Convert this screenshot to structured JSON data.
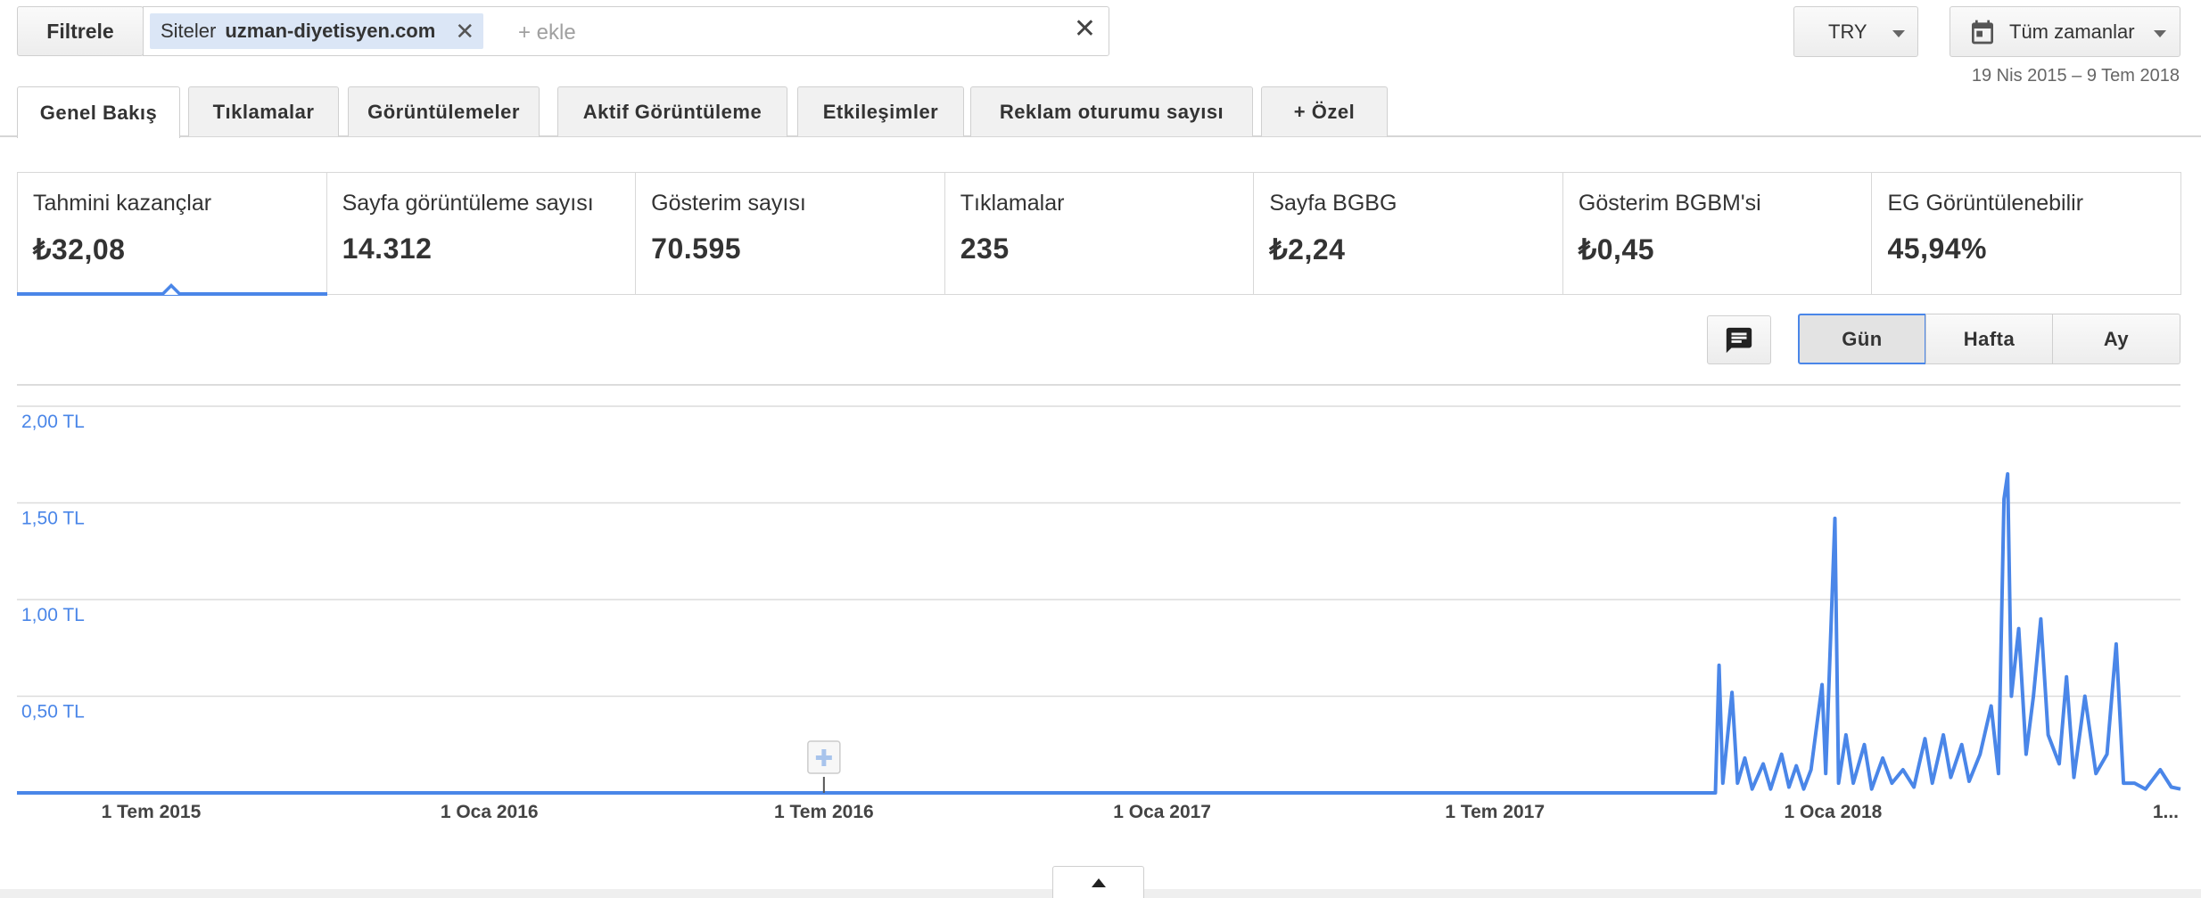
{
  "filter": {
    "button_label": "Filtrele",
    "chip_prefix": "Siteler",
    "chip_value": "uzman-diyetisyen.com",
    "add_placeholder": "+ ekle"
  },
  "currency": {
    "label": "TRY"
  },
  "time_range": {
    "label": "Tüm zamanlar",
    "range_text": "19 Nis 2015 – 9 Tem 2018"
  },
  "tabs": [
    {
      "label": "Genel Bakış",
      "active": true
    },
    {
      "label": "Tıklamalar"
    },
    {
      "label": "Görüntülemeler"
    },
    {
      "label": "Aktif Görüntüleme"
    },
    {
      "label": "Etkileşimler"
    },
    {
      "label": "Reklam oturumu sayısı"
    },
    {
      "label": "+ Özel"
    }
  ],
  "metrics": [
    {
      "label": "Tahmini kazançlar",
      "value": "₺32,08",
      "selected": true
    },
    {
      "label": "Sayfa görüntüleme sayısı",
      "value": "14.312"
    },
    {
      "label": "Gösterim sayısı",
      "value": "70.595"
    },
    {
      "label": "Tıklamalar",
      "value": "235"
    },
    {
      "label": "Sayfa BGBG",
      "value": "₺2,24"
    },
    {
      "label": "Gösterim BGBM'si",
      "value": "₺0,45"
    },
    {
      "label": "EG Görüntülenebilir",
      "value": "45,94%"
    }
  ],
  "granularity": {
    "day": "Gün",
    "week": "Hafta",
    "month": "Ay",
    "selected": "Gün"
  },
  "icons": {
    "comment": "comment-icon",
    "calendar": "calendar-icon",
    "clear": "close-icon",
    "collapse": "chevron-up-icon",
    "annotation": "plus-icon"
  },
  "colors": {
    "series": "#4a86e8",
    "axis_label": "#4a86e8"
  },
  "chart_data": {
    "type": "line",
    "y_tick_labels": [
      "2,00 TL",
      "1,50 TL",
      "1,00 TL",
      "0,50 TL"
    ],
    "ylim": [
      0,
      2.0
    ],
    "x_tick_labels": [
      "1 Tem 2015",
      "1 Oca 2016",
      "1 Tem 2016",
      "1 Oca 2017",
      "1 Tem 2017",
      "1 Oca 2018",
      "1..."
    ],
    "x_range": [
      "2015-04-19",
      "2018-07-09"
    ],
    "grid": true,
    "series": [
      {
        "points": [
          [
            "2015-04-19",
            0
          ],
          [
            "2017-10-29",
            0
          ],
          [
            "2017-10-31",
            0.66
          ],
          [
            "2017-11-02",
            0.05
          ],
          [
            "2017-11-07",
            0.52
          ],
          [
            "2017-11-10",
            0.05
          ],
          [
            "2017-11-14",
            0.18
          ],
          [
            "2017-11-18",
            0.02
          ],
          [
            "2017-11-24",
            0.15
          ],
          [
            "2017-11-28",
            0.02
          ],
          [
            "2017-12-04",
            0.2
          ],
          [
            "2017-12-08",
            0.03
          ],
          [
            "2017-12-12",
            0.14
          ],
          [
            "2017-12-16",
            0.02
          ],
          [
            "2017-12-20",
            0.12
          ],
          [
            "2017-12-26",
            0.56
          ],
          [
            "2017-12-28",
            0.1
          ],
          [
            "2018-01-02",
            1.42
          ],
          [
            "2018-01-04",
            0.05
          ],
          [
            "2018-01-08",
            0.3
          ],
          [
            "2018-01-12",
            0.05
          ],
          [
            "2018-01-18",
            0.25
          ],
          [
            "2018-01-22",
            0.02
          ],
          [
            "2018-01-28",
            0.18
          ],
          [
            "2018-02-02",
            0.05
          ],
          [
            "2018-02-08",
            0.12
          ],
          [
            "2018-02-14",
            0.03
          ],
          [
            "2018-02-20",
            0.28
          ],
          [
            "2018-02-24",
            0.05
          ],
          [
            "2018-03-02",
            0.3
          ],
          [
            "2018-03-06",
            0.08
          ],
          [
            "2018-03-12",
            0.25
          ],
          [
            "2018-03-16",
            0.06
          ],
          [
            "2018-03-22",
            0.2
          ],
          [
            "2018-03-28",
            0.45
          ],
          [
            "2018-04-01",
            0.1
          ],
          [
            "2018-04-04",
            1.52
          ],
          [
            "2018-04-06",
            1.65
          ],
          [
            "2018-04-08",
            0.5
          ],
          [
            "2018-04-12",
            0.85
          ],
          [
            "2018-04-16",
            0.2
          ],
          [
            "2018-04-20",
            0.5
          ],
          [
            "2018-04-24",
            0.9
          ],
          [
            "2018-04-28",
            0.3
          ],
          [
            "2018-05-04",
            0.15
          ],
          [
            "2018-05-08",
            0.6
          ],
          [
            "2018-05-12",
            0.08
          ],
          [
            "2018-05-18",
            0.5
          ],
          [
            "2018-05-24",
            0.1
          ],
          [
            "2018-05-30",
            0.2
          ],
          [
            "2018-06-04",
            0.77
          ],
          [
            "2018-06-08",
            0.05
          ],
          [
            "2018-06-14",
            0.05
          ],
          [
            "2018-06-20",
            0.02
          ],
          [
            "2018-06-28",
            0.12
          ],
          [
            "2018-07-04",
            0.03
          ],
          [
            "2018-07-09",
            0.02
          ]
        ]
      }
    ]
  }
}
